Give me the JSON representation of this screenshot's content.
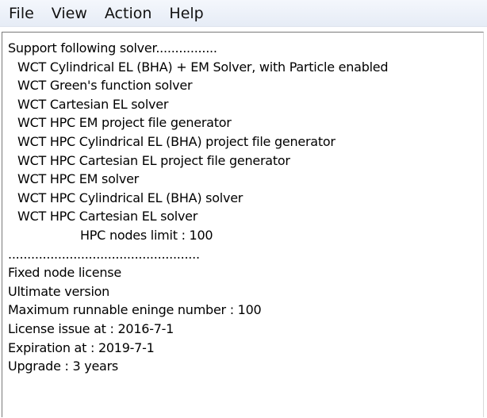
{
  "menubar": {
    "items": [
      "File",
      "View",
      "Action",
      "Help"
    ]
  },
  "license_text": {
    "lines": [
      "Support following solver................",
      "WCT Cylindrical EL (BHA) + EM Solver, with Particle enabled",
      "WCT Green's function solver",
      "WCT Cartesian EL solver",
      "WCT HPC EM project file generator",
      "WCT HPC Cylindrical EL (BHA) project file generator",
      "WCT HPC Cartesian EL project file generator",
      "WCT HPC EM solver",
      "WCT HPC Cylindrical EL (BHA) solver",
      "WCT HPC Cartesian EL solver",
      "HPC nodes limit : 100",
      "..................................................",
      "Fixed node license",
      "Ultimate version",
      "Maximum runnable eninge number : 100",
      "License issue at : 2016-7-1",
      "Expiration at : 2019-7-1",
      "Upgrade : 3 years"
    ]
  }
}
